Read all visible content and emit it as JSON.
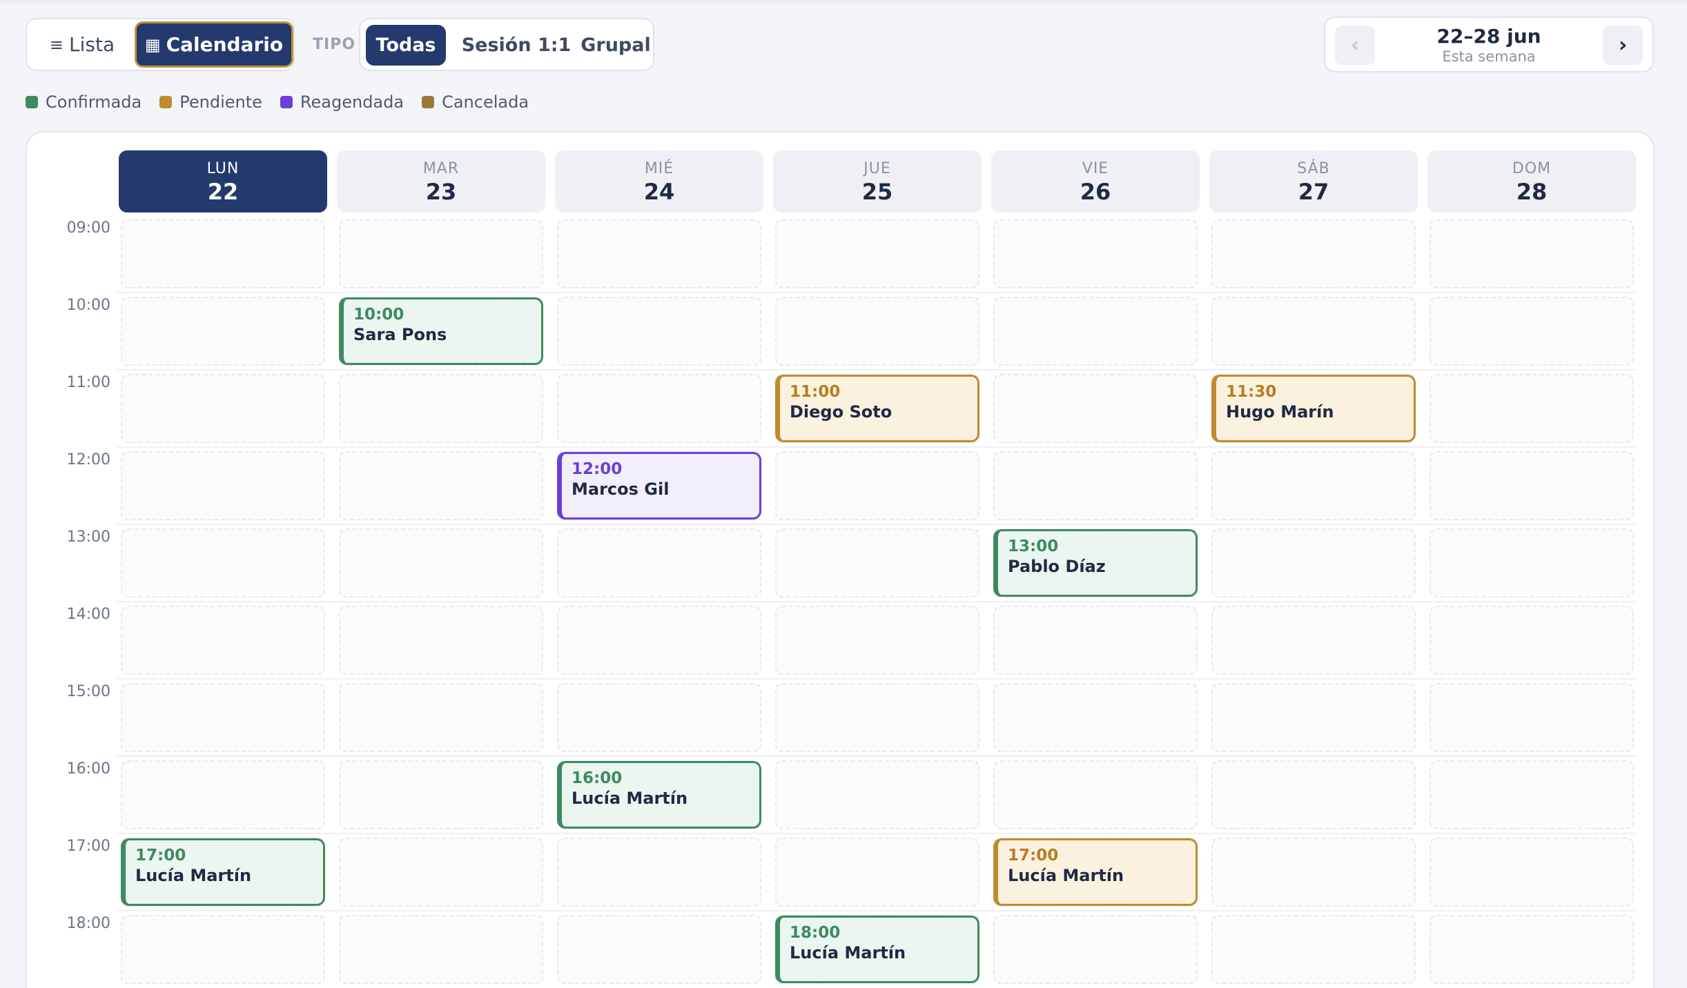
{
  "view_toggle": {
    "list_label": "Lista",
    "calendar_label": "Calendario",
    "list_icon": "list-icon",
    "calendar_icon": "calendar-icon"
  },
  "type_filter": {
    "label": "TIPO",
    "options": [
      "Todas",
      "Sesión 1:1",
      "Grupal"
    ],
    "selected": "Todas"
  },
  "week_nav": {
    "range": "22–28 jun",
    "subtitle": "Esta semana",
    "prev_glyph": "‹",
    "next_glyph": "›"
  },
  "legend": [
    {
      "label": "Confirmada",
      "color": "#3e8a5f"
    },
    {
      "label": "Pendiente",
      "color": "#c08b2e"
    },
    {
      "label": "Reagendada",
      "color": "#6e3ed8"
    },
    {
      "label": "Cancelada",
      "color": "#9a7a3c"
    }
  ],
  "days": [
    {
      "name": "LUN",
      "date": "22",
      "today": true
    },
    {
      "name": "MAR",
      "date": "23"
    },
    {
      "name": "MIÉ",
      "date": "24"
    },
    {
      "name": "JUE",
      "date": "25"
    },
    {
      "name": "VIE",
      "date": "26"
    },
    {
      "name": "SÁB",
      "date": "27"
    },
    {
      "name": "DOM",
      "date": "28"
    }
  ],
  "hours": [
    "09:00",
    "10:00",
    "11:00",
    "12:00",
    "13:00",
    "14:00",
    "15:00",
    "16:00",
    "17:00",
    "18:00"
  ],
  "events": [
    {
      "day": 1,
      "time": "10:00",
      "name": "Sara Pons",
      "status": "confirmed"
    },
    {
      "day": 3,
      "time": "11:00",
      "name": "Diego Soto",
      "status": "pending"
    },
    {
      "day": 5,
      "time": "11:30",
      "name": "Hugo Marín",
      "status": "pending"
    },
    {
      "day": 2,
      "time": "12:00",
      "name": "Marcos Gil",
      "status": "rescheduled"
    },
    {
      "day": 4,
      "time": "13:00",
      "name": "Pablo Díaz",
      "status": "confirmed"
    },
    {
      "day": 2,
      "time": "16:00",
      "name": "Lucía Martín",
      "status": "confirmed"
    },
    {
      "day": 0,
      "time": "17:00",
      "name": "Lucía Martín",
      "status": "confirmed"
    },
    {
      "day": 4,
      "time": "17:00",
      "name": "Lucía Martín",
      "status": "pending"
    },
    {
      "day": 3,
      "time": "18:00",
      "name": "Lucía Martín",
      "status": "confirmed"
    }
  ]
}
